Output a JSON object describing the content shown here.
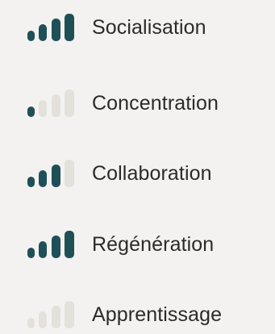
{
  "colors": {
    "background": "#f4f2f0",
    "bar_active": "#1f5058",
    "bar_inactive": "#e4e1dd",
    "text": "#2b2b2b"
  },
  "items": [
    {
      "label": "Socialisation",
      "icon": "signal-strength-icon",
      "level": 4,
      "max": 4
    },
    {
      "label": "Concentration",
      "icon": "signal-strength-icon",
      "level": 1,
      "max": 4
    },
    {
      "label": "Collaboration",
      "icon": "signal-strength-icon",
      "level": 3,
      "max": 4
    },
    {
      "label": "Régénération",
      "icon": "signal-strength-icon",
      "level": 4,
      "max": 4
    },
    {
      "label": "Apprentissage",
      "icon": "signal-strength-icon",
      "level": 0,
      "max": 4
    }
  ]
}
